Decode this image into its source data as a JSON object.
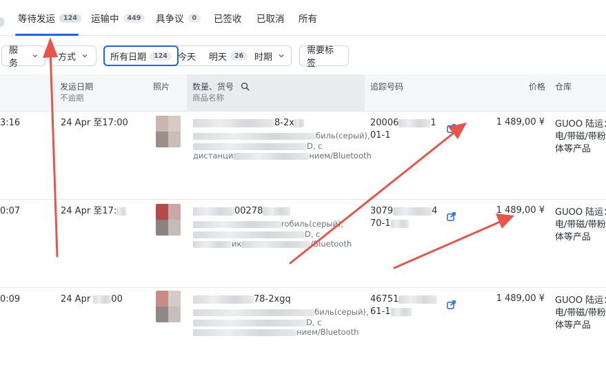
{
  "tabs": [
    {
      "label": "等待发运",
      "badge": "124",
      "active": true
    },
    {
      "label": "运输中",
      "badge": "449"
    },
    {
      "label": "具争议",
      "badge": "0"
    },
    {
      "label": "已签收"
    },
    {
      "label": "已取消"
    },
    {
      "label": "所有"
    }
  ],
  "filters": {
    "service": "服务",
    "method": "方式",
    "date_segments": [
      {
        "label": "所有日期",
        "badge": "124",
        "active": true
      },
      {
        "label": "今天"
      },
      {
        "label": "明天",
        "badge": "26"
      },
      {
        "label": "时期"
      }
    ],
    "tags": "需要标签"
  },
  "columns": {
    "ship_date": "发运日期",
    "ship_date_sub": "不逾期",
    "photo": "照片",
    "qty_sku": "数量、货号",
    "product_name": "商品名称",
    "tracking": "追踪号码",
    "price": "价格",
    "warehouse": "仓库"
  },
  "rows": [
    {
      "time": "3:16",
      "ship_date": "24 Apr 至17:00",
      "sku": "8-2x",
      "desc_line1": "биль(серый),",
      "desc_line2": "D, с",
      "desc_line3_prefix": "дистанци",
      "desc_line3_suffix": "нием/Bluetooth",
      "tracking_prefix": "20006",
      "tracking_suffix": "1",
      "tracking_line2": "01-1",
      "price": "1 489,00 ¥",
      "warehouse_l1": "GUOO 陆运：",
      "warehouse_l2": "电/带磁/带粉",
      "warehouse_l3": "体等产品"
    },
    {
      "time": "0:07",
      "ship_date": "24 Apr 至17:",
      "sku": "00278",
      "desc_line1": "roбиль(серый),",
      "desc_line2": "D, с",
      "desc_line3_prefix": "ик",
      "desc_line3_suffix": "/Bluetooth",
      "tracking_prefix": "3079",
      "tracking_suffix": "4",
      "tracking_line2": "70-1",
      "price": "1 489,00 ¥",
      "warehouse_l1": "GUOO 陆运：",
      "warehouse_l2": "电/带磁/带粉",
      "warehouse_l3": "体等产品"
    },
    {
      "time": "0:09",
      "ship_date_prefix": "24 Apr ",
      "ship_date_suffix": "00",
      "sku": "78-2xgq",
      "desc_line1": "биль(серый),",
      "desc_line2": "D, с",
      "desc_line3_prefix": "",
      "desc_line3_suffix": "нием/Bluetooth",
      "tracking_prefix": "46751",
      "tracking_suffix": "",
      "tracking_line2": "61-1",
      "price": "1 489,00 ¥",
      "warehouse_l1": "GUOO 陆运：",
      "warehouse_l2": "电/带磁/带粉",
      "warehouse_l3": "体等产品"
    }
  ],
  "colors": {
    "accent": "#1c64f2",
    "annotation_arrow": "#e8534a"
  }
}
